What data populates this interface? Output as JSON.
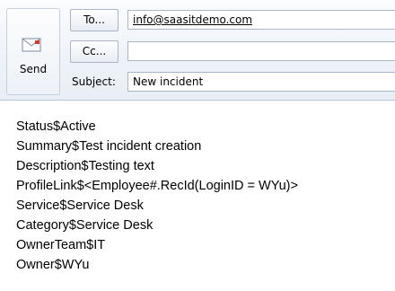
{
  "toolbar": {
    "send_label": "Send",
    "to_label": "To...",
    "cc_label": "Cc...",
    "subject_label": "Subject:"
  },
  "fields": {
    "to_value": "info@saasitdemo.com",
    "cc_value": "",
    "subject_value": "New incident"
  },
  "icons": {
    "send": "envelope-send-icon"
  },
  "body": {
    "lines": [
      "Status$Active",
      "Summary$Test incident creation",
      "Description$Testing text",
      "ProfileLink$<Employee#.RecId(LoginID = WYu)>",
      "Service$Service Desk",
      "Category$Service Desk",
      "OwnerTeam$IT",
      "Owner$WYu"
    ]
  }
}
